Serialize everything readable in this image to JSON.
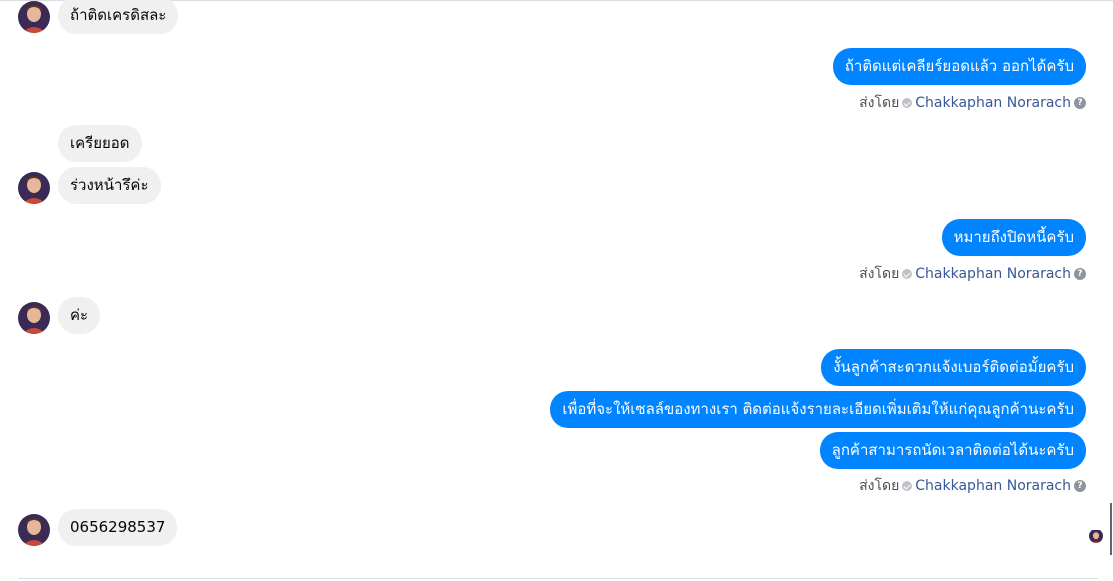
{
  "messages": {
    "m1": "ถ้าติดเครดิสละ",
    "m2": "ถ้าติดแต่เคลียร์ยอดแล้ว ออกได้ครับ",
    "m3": "เครียยอด",
    "m4": "ร่วงหน้ารึค่ะ",
    "m5": "หมายถึงปิดหนี้ครับ",
    "m6": "ค่ะ",
    "m7": "งั้นลูกค้าสะดวกแจ้งเบอร์ติดต่อมั้ยครับ",
    "m8": "เพื่อที่จะให้เซลล์ของทางเรา ติดต่อแจ้งรายละเอียดเพิ่มเติมให้แก่คุณลูกค้านะครับ",
    "m9": "ลูกค้าสามารถนัดเวลาติดต่อได้นะครับ",
    "m10": "0656298537"
  },
  "sent_by": {
    "prefix": "ส่งโดย",
    "name": "Chakkaphan Norarach",
    "help": "?"
  },
  "colors": {
    "outgoing": "#0084ff",
    "incoming": "#f0f0f0",
    "sender_name": "#385898"
  },
  "icons": {
    "verified": "check-icon",
    "help": "help-icon",
    "avatar": "profile-photo"
  }
}
